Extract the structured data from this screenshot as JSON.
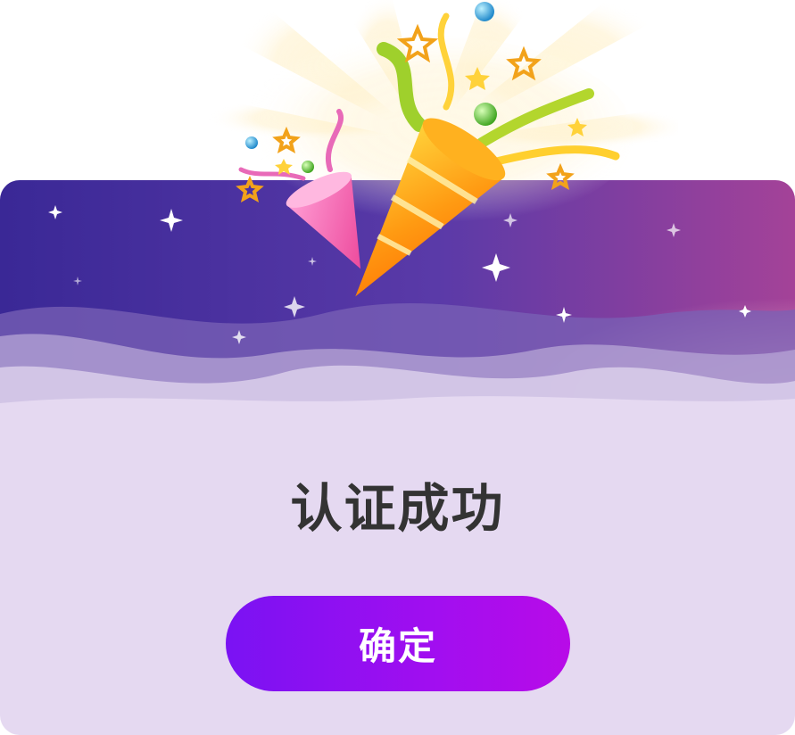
{
  "dialog": {
    "title": "认证成功",
    "confirm_label": "确定"
  },
  "colors": {
    "header_start": "#3a2896",
    "header_end": "#a0409a",
    "card_body": "#e5d9f1",
    "button_start": "#7a12f3",
    "button_end": "#b80be8",
    "title_text": "#333333"
  },
  "icons": [
    "party-popper-icon",
    "confetti-icon",
    "sparkle-icon"
  ]
}
